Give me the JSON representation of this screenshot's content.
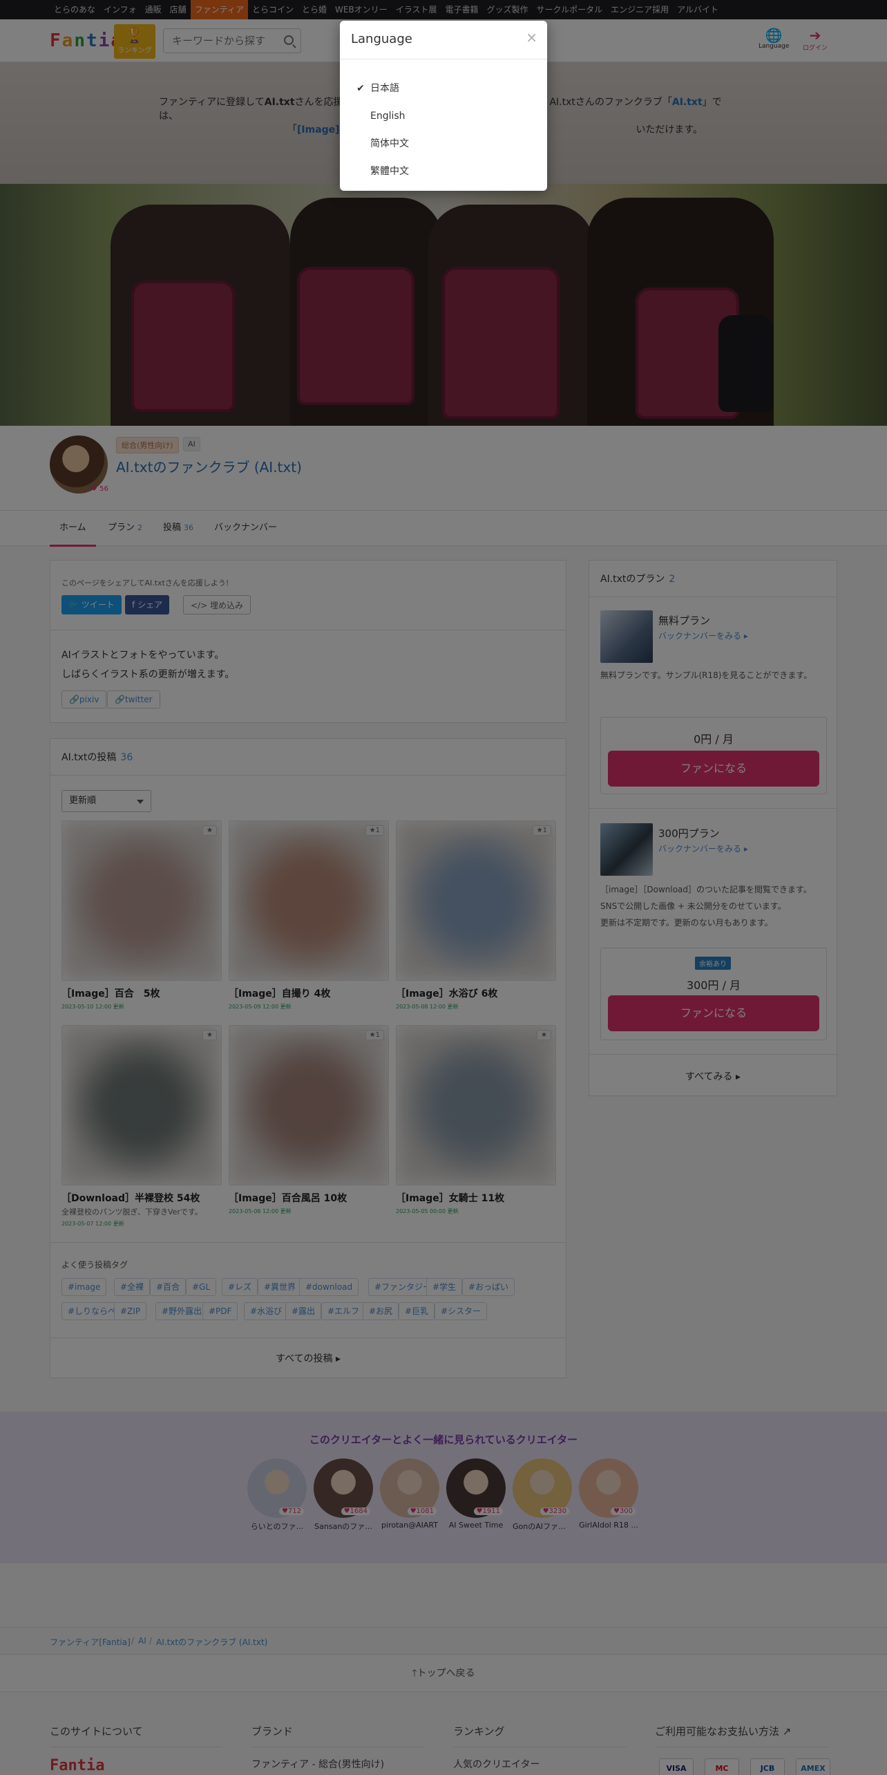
{
  "netbar": {
    "items": [
      "とらのあな",
      "インフォ",
      "通販",
      "店舗",
      "ファンティア",
      "とらコイン",
      "とら婚",
      "WEBオンリー",
      "イラスト展",
      "電子書籍",
      "グッズ製作",
      "サークルポータル",
      "エンジニア採用",
      "アルバイト"
    ],
    "active": "ファンティア"
  },
  "header": {
    "logo": "Fantia",
    "rank_label": "ランキング",
    "search_placeholder": "キーワードから探す",
    "language_label": "Language",
    "login_label": "ログイン"
  },
  "notice": {
    "pre": "ファンティアに登録して",
    "creator": "AI.txt",
    "mid": "さんを応援",
    "mid2": "AI.txtさんのファンクラブ「",
    "club": "AI.txt",
    "post": "」では、",
    "line2_pre": "「",
    "line2_link": "[Image] 百",
    "line2_post": "いただけます。"
  },
  "profile": {
    "fans": "56",
    "category": "総合(男性向け)",
    "tag": "AI",
    "title": "AI.txtのファンクラブ (AI.txt)"
  },
  "tabs": [
    {
      "label": "ホーム",
      "count": ""
    },
    {
      "label": "プラン",
      "count": "2"
    },
    {
      "label": "投稿",
      "count": "36"
    },
    {
      "label": "バックナンバー",
      "count": ""
    }
  ],
  "share": {
    "lead": "このページをシェアしてAI.txtさんを応援しよう!",
    "tweet": "ツイート",
    "share": "シェア",
    "embed": "</> 埋め込み"
  },
  "bio": {
    "line1": "AIイラストとフォトをやっています。",
    "line2": "しばらくイラスト系の更新が増えます。",
    "links": [
      "pixiv",
      "twitter"
    ]
  },
  "posts_section": {
    "title": "AI.txtの投稿",
    "count": "36",
    "sort": "更新順",
    "posts": [
      {
        "title": "［Image］百合　5枚",
        "sub": "",
        "date": "2023-05-10 12:00  更新",
        "likes": "",
        "color": "#b79a93"
      },
      {
        "title": "［Image］自撮り 4枚",
        "sub": "",
        "date": "2023-05-09 12:00  更新",
        "likes": "1",
        "color": "#b88a78"
      },
      {
        "title": "［Image］水浴び 6枚",
        "sub": "",
        "date": "2023-05-08 12:00  更新",
        "likes": "1",
        "color": "#8aa2c0"
      },
      {
        "title": "［Download］半裸登校 54枚",
        "sub": "全裸登校のパンツ脱ぎ、下穿きVerです。",
        "date": "2023-05-07 12:00  更新",
        "likes": "",
        "color": "#6f7a78"
      },
      {
        "title": "［Image］百合風呂 10枚",
        "sub": "",
        "date": "2023-05-06 12:00  更新",
        "likes": "1",
        "color": "#a6857c"
      },
      {
        "title": "［Image］女騎士 11枚",
        "sub": "",
        "date": "2023-05-05 00:00  更新",
        "likes": "",
        "color": "#8a9aa8"
      }
    ],
    "tags_head": "よく使う投稿タグ",
    "tags": [
      "#image",
      "#全裸",
      "#百合",
      "#GL",
      "#レズ",
      "#異世界",
      "#download",
      "#ファンタジー",
      "#学生",
      "#おっぱい",
      "#しりならべ",
      "#ZIP",
      "#野外露出",
      "#PDF",
      "#水浴び",
      "#露出",
      "#エルフ",
      "#お尻",
      "#巨乳",
      "#シスター"
    ],
    "all_label": "すべての投稿"
  },
  "plans_section": {
    "title": "AI.txtのプラン",
    "count": "2",
    "plans": [
      {
        "name": "無料プラン",
        "back": "バックナンバーをみる",
        "desc": [
          "無料プランです。サンプル(R18)を見ることができます。"
        ],
        "price": "0円 / 月",
        "remain": "",
        "button": "ファンになる"
      },
      {
        "name": "300円プラン",
        "back": "バックナンバーをみる",
        "desc": [
          "［image］［Download］のついた記事を閲覧できます。",
          "SNSで公開した画像 + 未公開分をのせています。",
          "更新は不定期です。更新のない月もあります。"
        ],
        "price": "300円 / 月",
        "remain": "余裕あり",
        "button": "ファンになる"
      }
    ],
    "all_label": "すべてみる"
  },
  "related": {
    "title": "このクリエイターとよく一緒に見られているクリエイター",
    "creators": [
      {
        "name": "らいとのファ...",
        "fans": "712",
        "color": "#c9cfe0"
      },
      {
        "name": "Sansanのファ...",
        "fans": "1684",
        "color": "#6a5148"
      },
      {
        "name": "pirotan@AIART",
        "fans": "1081",
        "color": "#d8b7a2"
      },
      {
        "name": "AI Sweet Time",
        "fans": "1911",
        "color": "#4b3a36"
      },
      {
        "name": "GonのAIファン...",
        "fans": "3230",
        "color": "#e8c37a"
      },
      {
        "name": "GirlAIdol R18 ...",
        "fans": "300",
        "color": "#e6b59a"
      }
    ]
  },
  "breadcrumb": [
    "ファンティア[Fantia]",
    "AI",
    "AI.txtのファンクラブ (AI.txt)"
  ],
  "totop": "トップへ戻る",
  "footer": {
    "cols": [
      {
        "head": "このサイトについて",
        "item": "Fantia"
      },
      {
        "head": "ブランド",
        "item": "ファンティア - 総合(男性向け)"
      },
      {
        "head": "ランキング",
        "item": "人気のクリエイター"
      },
      {
        "head": "ご利用可能なお支払い方法",
        "item": ""
      }
    ],
    "payments": [
      "VISA",
      "MC",
      "JCB",
      "AMEX"
    ]
  },
  "modal": {
    "title": "Language",
    "close": "×",
    "items": [
      "日本語",
      "English",
      "简体中文",
      "繁體中文"
    ],
    "selected": "日本語"
  }
}
